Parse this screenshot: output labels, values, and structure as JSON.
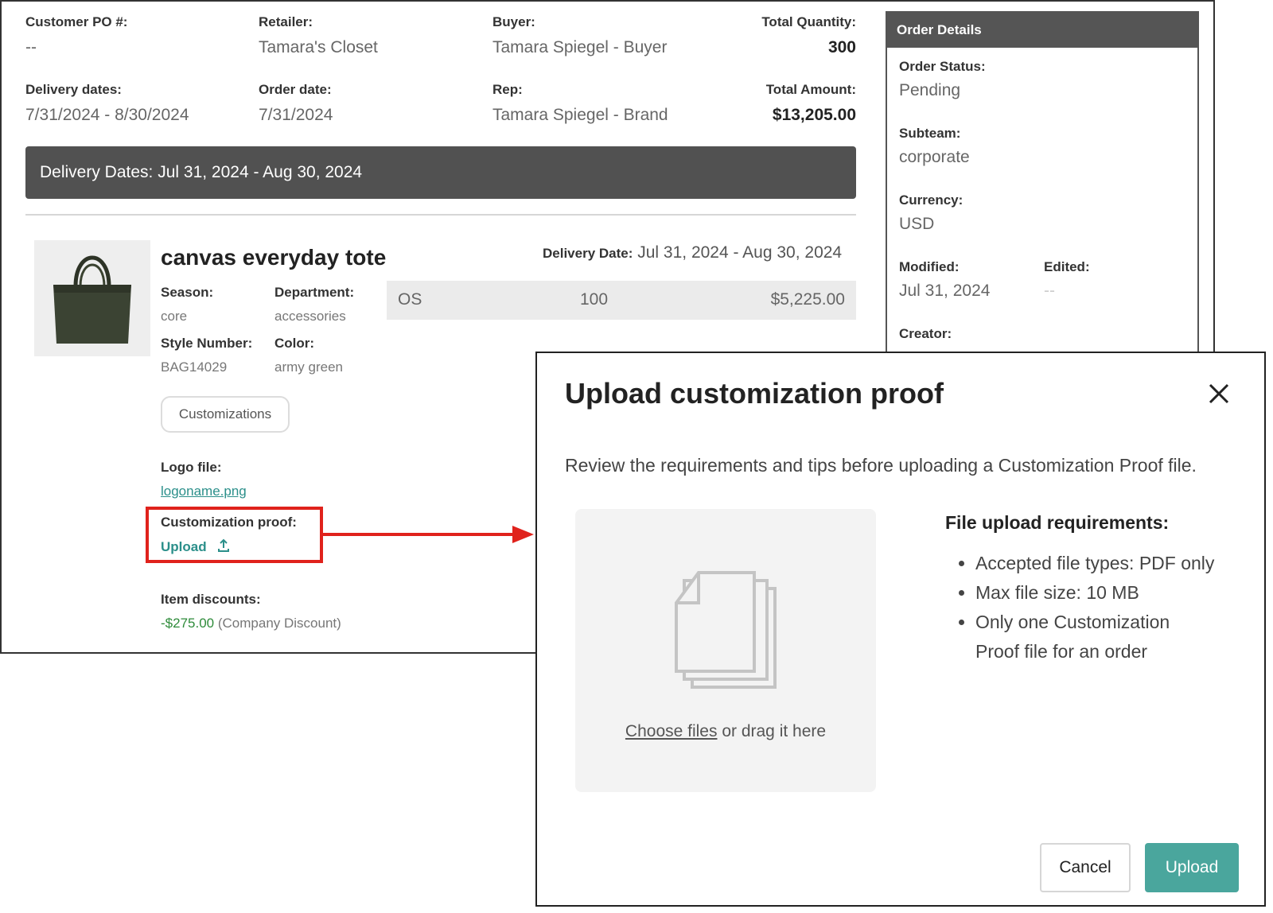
{
  "order": {
    "customer_po_label": "Customer PO #:",
    "customer_po_value": "--",
    "retailer_label": "Retailer:",
    "retailer_value": "Tamara's Closet",
    "buyer_label": "Buyer:",
    "buyer_value": "Tamara Spiegel - Buyer",
    "total_qty_label": "Total Quantity:",
    "total_qty_value": "300",
    "delivery_dates_label": "Delivery dates:",
    "delivery_dates_value": "7/31/2024 - 8/30/2024",
    "order_date_label": "Order date:",
    "order_date_value": "7/31/2024",
    "rep_label": "Rep:",
    "rep_value": "Tamara Spiegel - Brand",
    "total_amount_label": "Total Amount:",
    "total_amount_value": "$13,205.00"
  },
  "delivery_bar": "Delivery Dates: Jul 31, 2024 - Aug 30, 2024",
  "item": {
    "title": "canvas everyday tote",
    "season_label": "Season:",
    "season_value": "core",
    "department_label": "Department:",
    "department_value": "accessories",
    "style_label": "Style Number:",
    "style_value": "BAG14029",
    "color_label": "Color:",
    "color_value": "army green",
    "delivery_date_label": "Delivery Date:",
    "delivery_date_value": "Jul 31, 2024 - Aug 30, 2024",
    "size_row": {
      "size": "OS",
      "qty": "100",
      "price": "$5,225.00"
    },
    "customizations_button": "Customizations",
    "logo_file_label": "Logo file:",
    "logo_file_link": "logoname.png",
    "proof_label": "Customization proof:",
    "proof_upload": "Upload",
    "discount_label": "Item discounts:",
    "discount_amount": "-$275.00",
    "discount_note": "(Company Discount)"
  },
  "order_details": {
    "header": "Order Details",
    "status_label": "Order Status:",
    "status_value": "Pending",
    "subteam_label": "Subteam:",
    "subteam_value": "corporate",
    "currency_label": "Currency:",
    "currency_value": "USD",
    "modified_label": "Modified:",
    "modified_value": "Jul 31, 2024",
    "edited_label": "Edited:",
    "edited_value": "--",
    "creator_label": "Creator:"
  },
  "modal": {
    "title": "Upload customization proof",
    "description": "Review the requirements and tips before uploading a Customization Proof file.",
    "choose_files": "Choose files",
    "drag_text": " or drag it here",
    "req_title": "File upload requirements:",
    "requirements": [
      "Accepted file types: PDF only",
      "Max file size: 10 MB",
      "Only one Customization Proof file for an order"
    ],
    "cancel": "Cancel",
    "upload": "Upload"
  },
  "colors": {
    "accent": "#4aa69d",
    "link": "#2b8f8a",
    "discount": "#2e8b3a",
    "highlight": "#e0221c",
    "bar": "#515151"
  }
}
